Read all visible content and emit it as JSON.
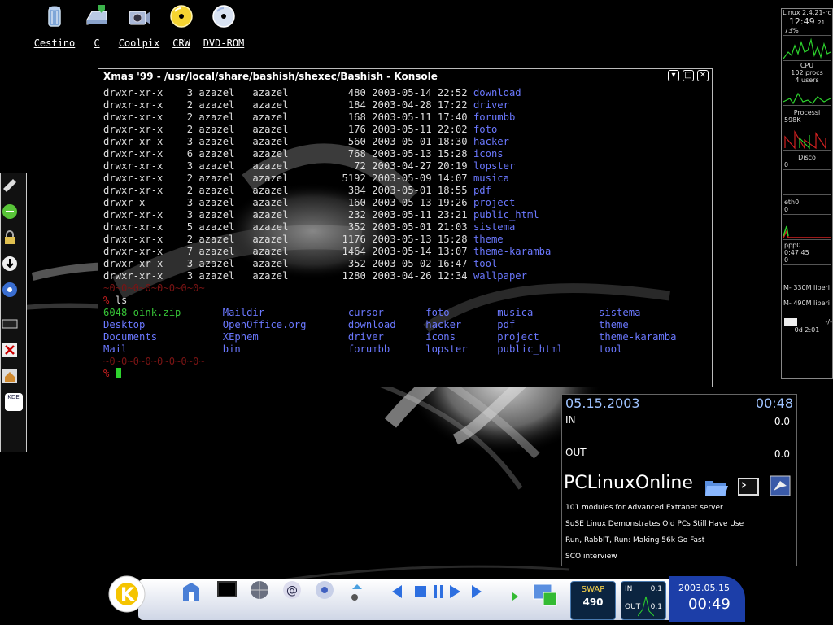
{
  "desktop_icons": [
    {
      "label": "Cestino",
      "icon": "trash-icon"
    },
    {
      "label": "C",
      "icon": "drive-icon"
    },
    {
      "label": "Coolpix",
      "icon": "camera-icon"
    },
    {
      "label": "CRW",
      "icon": "cd-icon"
    },
    {
      "label": "DVD-ROM",
      "icon": "dvd-icon"
    }
  ],
  "konsole": {
    "title": "Xmas '99 - /usr/local/share/bashish/shexec/Bashish - Konsole",
    "listing": [
      {
        "perm": "drwxr-xr-x",
        "links": "3",
        "user": "azazel",
        "group": "azazel",
        "size": "480",
        "date": "2003-05-14",
        "time": "22:52",
        "name": "download"
      },
      {
        "perm": "drwxr-xr-x",
        "links": "2",
        "user": "azazel",
        "group": "azazel",
        "size": "184",
        "date": "2003-04-28",
        "time": "17:22",
        "name": "driver"
      },
      {
        "perm": "drwxr-xr-x",
        "links": "2",
        "user": "azazel",
        "group": "azazel",
        "size": "168",
        "date": "2003-05-11",
        "time": "17:40",
        "name": "forumbb"
      },
      {
        "perm": "drwxr-xr-x",
        "links": "2",
        "user": "azazel",
        "group": "azazel",
        "size": "176",
        "date": "2003-05-11",
        "time": "22:02",
        "name": "foto"
      },
      {
        "perm": "drwxr-xr-x",
        "links": "3",
        "user": "azazel",
        "group": "azazel",
        "size": "560",
        "date": "2003-05-01",
        "time": "18:30",
        "name": "hacker"
      },
      {
        "perm": "drwxr-xr-x",
        "links": "6",
        "user": "azazel",
        "group": "azazel",
        "size": "768",
        "date": "2003-05-13",
        "time": "15:28",
        "name": "icons"
      },
      {
        "perm": "drwxr-xr-x",
        "links": "3",
        "user": "azazel",
        "group": "azazel",
        "size": "72",
        "date": "2003-04-27",
        "time": "20:19",
        "name": "lopster"
      },
      {
        "perm": "drwxr-xr-x",
        "links": "2",
        "user": "azazel",
        "group": "azazel",
        "size": "5192",
        "date": "2003-05-09",
        "time": "14:07",
        "name": "musica"
      },
      {
        "perm": "drwxr-xr-x",
        "links": "2",
        "user": "azazel",
        "group": "azazel",
        "size": "384",
        "date": "2003-05-01",
        "time": "18:55",
        "name": "pdf"
      },
      {
        "perm": "drwxr-x---",
        "links": "3",
        "user": "azazel",
        "group": "azazel",
        "size": "160",
        "date": "2003-05-13",
        "time": "19:26",
        "name": "project"
      },
      {
        "perm": "drwxr-xr-x",
        "links": "3",
        "user": "azazel",
        "group": "azazel",
        "size": "232",
        "date": "2003-05-11",
        "time": "23:21",
        "name": "public_html"
      },
      {
        "perm": "drwxr-xr-x",
        "links": "5",
        "user": "azazel",
        "group": "azazel",
        "size": "352",
        "date": "2003-05-01",
        "time": "21:03",
        "name": "sistema"
      },
      {
        "perm": "drwxr-xr-x",
        "links": "2",
        "user": "azazel",
        "group": "azazel",
        "size": "1176",
        "date": "2003-05-13",
        "time": "15:28",
        "name": "theme"
      },
      {
        "perm": "drwxr-xr-x",
        "links": "7",
        "user": "azazel",
        "group": "azazel",
        "size": "1464",
        "date": "2003-05-14",
        "time": "13:07",
        "name": "theme-karamba"
      },
      {
        "perm": "drwxr-xr-x",
        "links": "3",
        "user": "azazel",
        "group": "azazel",
        "size": "352",
        "date": "2003-05-02",
        "time": "16:47",
        "name": "tool"
      },
      {
        "perm": "drwxr-xr-x",
        "links": "3",
        "user": "azazel",
        "group": "azazel",
        "size": "1280",
        "date": "2003-04-26",
        "time": "12:34",
        "name": "wallpaper"
      }
    ],
    "decor_line_1": "~0~0~0~0~0~0~0~0~",
    "prompt_symbol": "%",
    "command": "ls",
    "ls_rows": [
      [
        {
          "t": "6048-oink.zip",
          "c": "exe"
        },
        {
          "t": "Maildir",
          "c": "dir"
        },
        {
          "t": "cursor",
          "c": "dir"
        },
        {
          "t": "foto",
          "c": "dir"
        },
        {
          "t": "musica",
          "c": "dir"
        },
        {
          "t": "sistema",
          "c": "dir"
        },
        {
          "t": "wallpaper",
          "c": "dir"
        }
      ],
      [
        {
          "t": "Desktop",
          "c": "dir"
        },
        {
          "t": "OpenOffice.org",
          "c": "dir"
        },
        {
          "t": "download",
          "c": "dir"
        },
        {
          "t": "hacker",
          "c": "dir"
        },
        {
          "t": "pdf",
          "c": "dir"
        },
        {
          "t": "theme",
          "c": "dir"
        },
        {
          "t": "",
          "c": "dir"
        }
      ],
      [
        {
          "t": "Documents",
          "c": "dir"
        },
        {
          "t": "XEphem",
          "c": "dir"
        },
        {
          "t": "driver",
          "c": "dir"
        },
        {
          "t": "icons",
          "c": "dir"
        },
        {
          "t": "project",
          "c": "dir"
        },
        {
          "t": "theme-karamba",
          "c": "dir"
        },
        {
          "t": "",
          "c": "dir"
        }
      ],
      [
        {
          "t": "Mail",
          "c": "dir"
        },
        {
          "t": "bin",
          "c": "dir"
        },
        {
          "t": "forumbb",
          "c": "dir"
        },
        {
          "t": "lopster",
          "c": "dir"
        },
        {
          "t": "public_html",
          "c": "dir"
        },
        {
          "t": "tool",
          "c": "dir"
        },
        {
          "t": "",
          "c": "dir"
        }
      ]
    ],
    "decor_line_2": "~0~0~0~0~0~0~0~0~"
  },
  "sysmon": {
    "kernel": "Linux 2.4.21-rc",
    "clock": "12:49",
    "clock_sec": "21",
    "mem_pct": "73%",
    "cpu_label": "CPU",
    "procs": "102 procs",
    "users": "4 users",
    "processi_label": "Processi",
    "processi_value": "598K",
    "disco_label": "Disco",
    "disco_value": "0",
    "eth_label": "eth0",
    "eth_value": "0",
    "ppp_label": "ppp0",
    "ppp_time": "0:47 45",
    "ppp_value": "0",
    "mem1": "M- 330M liberi",
    "mem2": "M- 490M liberi",
    "mail_extra": "-/-",
    "uptime": "0d 2:01"
  },
  "netwidget": {
    "date": "05.15.2003",
    "time": "00:48",
    "in_label": "IN",
    "in_value": "0.0",
    "out_label": "OUT",
    "out_value": "0.0",
    "brand": "PCLinuxOnline",
    "news": [
      "101 modules for Advanced Extranet server",
      "SuSE Linux Demonstrates Old PCs Still Have Use",
      "Run, RabbIT, Run: Making 56k Go Fast",
      "SCO interview"
    ]
  },
  "kicker": {
    "swap_label": "SWAP",
    "swap_value": "490",
    "net_in_label": "IN",
    "net_in_value": "0.1",
    "net_out_label": "OUT",
    "net_out_value": "0.1",
    "clock_date": "2003.05.15",
    "clock_time": "00:49"
  },
  "left_panel": {
    "kde_label": "KDE"
  }
}
